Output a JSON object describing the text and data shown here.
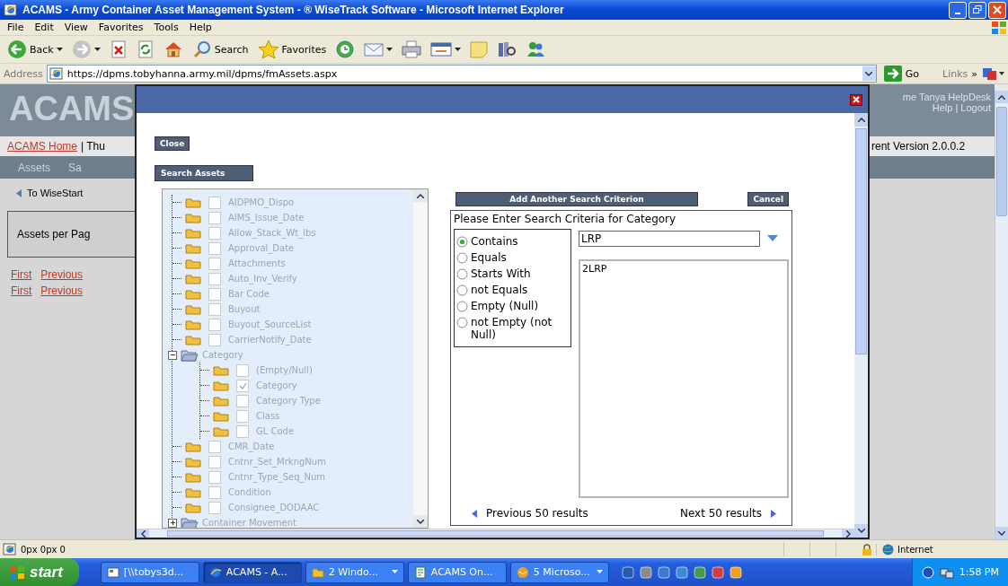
{
  "window": {
    "title": "ACAMS - Army Container Asset Management System - ® WiseTrack Software - Microsoft Internet Explorer"
  },
  "menu": [
    "File",
    "Edit",
    "View",
    "Favorites",
    "Tools",
    "Help"
  ],
  "toolbar": [
    {
      "kind": "back",
      "label": "Back",
      "dropdown": true
    },
    {
      "kind": "forward",
      "dropdown": true
    },
    {
      "kind": "stop"
    },
    {
      "kind": "refresh"
    },
    {
      "kind": "home"
    },
    {
      "kind": "search",
      "label": "Search"
    },
    {
      "kind": "favorites",
      "label": "Favorites"
    },
    {
      "kind": "media"
    },
    {
      "kind": "mail",
      "dropdown": true
    },
    {
      "kind": "print"
    },
    {
      "kind": "edit",
      "dropdown": true
    },
    {
      "kind": "note"
    },
    {
      "kind": "research"
    },
    {
      "kind": "messenger"
    }
  ],
  "address": {
    "label": "Address",
    "url": "https://dpms.tobyhanna.army.mil/dpms/fmAssets.aspx",
    "go": "Go",
    "links": "Links",
    "more": "»"
  },
  "page": {
    "logo": "ACAMS",
    "user": "me Tanya HelpDesk",
    "user_links": "Help | Logout",
    "home_link": "ACAMS Home",
    "crumb": "| Thu",
    "version": "rent Version 2.0.0.2",
    "nav": [
      "Assets",
      "Sa"
    ],
    "back_link": "To WiseStart",
    "box_label": "Assets per Pag",
    "pagers": [
      [
        "First",
        "Previous"
      ],
      [
        "First",
        "Previous"
      ]
    ]
  },
  "modal": {
    "close": "Close",
    "heading": "Search Assets",
    "tree": [
      {
        "kind": "field",
        "label": "AIDPMO_Dispo",
        "checked": false
      },
      {
        "kind": "field",
        "label": "AIMS_Issue_Date",
        "checked": false
      },
      {
        "kind": "field",
        "label": "Allow_Stack_Wt_lbs",
        "checked": false
      },
      {
        "kind": "field",
        "label": "Approval_Date",
        "checked": false
      },
      {
        "kind": "field",
        "label": "Attachments",
        "checked": false
      },
      {
        "kind": "field",
        "label": "Auto_Inv_Verify",
        "checked": false
      },
      {
        "kind": "field",
        "label": "Bar Code",
        "checked": false
      },
      {
        "kind": "field",
        "label": "Buyout",
        "checked": false
      },
      {
        "kind": "field",
        "label": "Buyout_SourceList",
        "checked": false
      },
      {
        "kind": "field",
        "label": "CarrierNotify_Date",
        "checked": false
      },
      {
        "kind": "group",
        "label": "Category",
        "expanded": true,
        "children": [
          {
            "kind": "field",
            "label": "(Empty/Null)",
            "checked": false
          },
          {
            "kind": "field",
            "label": "Category",
            "checked": true
          },
          {
            "kind": "field",
            "label": "Category Type",
            "checked": false
          },
          {
            "kind": "field",
            "label": "Class",
            "checked": false
          },
          {
            "kind": "field",
            "label": "GL Code",
            "checked": false
          }
        ]
      },
      {
        "kind": "field",
        "label": "CMR_Date",
        "checked": false
      },
      {
        "kind": "field",
        "label": "Cntnr_Set_MrkngNum",
        "checked": false
      },
      {
        "kind": "field",
        "label": "Cntnr_Type_Seq_Num",
        "checked": false
      },
      {
        "kind": "field",
        "label": "Condition",
        "checked": false
      },
      {
        "kind": "field",
        "label": "Consignee_DODAAC",
        "checked": false
      },
      {
        "kind": "group",
        "label": "Container Movement",
        "expanded": false
      }
    ],
    "add_button": "Add Another Search Criterion",
    "cancel": "Cancel",
    "criteria_title": "Please Enter Search Criteria for Category",
    "operators": [
      {
        "label": "Contains",
        "selected": true
      },
      {
        "label": "Equals",
        "selected": false
      },
      {
        "label": "Starts With",
        "selected": false
      },
      {
        "label": "not Equals",
        "selected": false
      },
      {
        "label": "Empty (Null)",
        "selected": false
      },
      {
        "label": "not Empty (not Null)",
        "selected": false
      }
    ],
    "value": "LRP",
    "results": [
      "2LRP"
    ],
    "previous": "Previous 50 results",
    "next": "Next 50 results"
  },
  "status_bar": {
    "text": "0px 0px 0",
    "zone": "Internet"
  },
  "taskbar": {
    "start": "start",
    "tasks": [
      {
        "label": "[\\\\tobys3d...",
        "selected": false,
        "grouped": false,
        "kind": "explorer"
      },
      {
        "label": "ACAMS - A...",
        "selected": true,
        "grouped": false,
        "kind": "browser"
      },
      {
        "label": "2 Windo...",
        "selected": false,
        "grouped": true,
        "kind": "folder"
      },
      {
        "label": "ACAMS On...",
        "selected": false,
        "grouped": false,
        "kind": "document"
      },
      {
        "label": "5 Microso...",
        "selected": false,
        "grouped": true,
        "kind": "mail"
      }
    ],
    "clock": "1:58 PM"
  }
}
